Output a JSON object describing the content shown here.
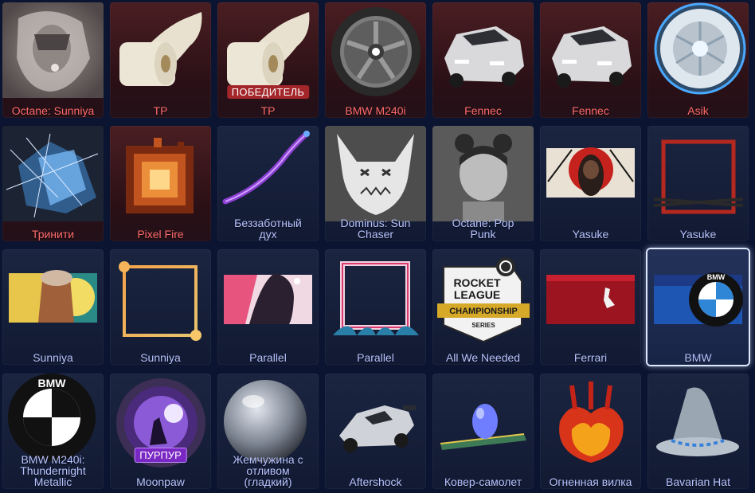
{
  "items": [
    {
      "name": "Octane: Sunniya",
      "rarity": "red"
    },
    {
      "name": "TP",
      "rarity": "red"
    },
    {
      "name": "TP",
      "rarity": "red",
      "badge": "ПОБЕДИТЕЛЬ"
    },
    {
      "name": "BMW M240i",
      "rarity": "red"
    },
    {
      "name": "Fennec",
      "rarity": "red"
    },
    {
      "name": "Fennec",
      "rarity": "red"
    },
    {
      "name": "Asik",
      "rarity": "red"
    },
    {
      "name": "Тринити",
      "rarity": "red"
    },
    {
      "name": "Pixel Fire",
      "rarity": "red"
    },
    {
      "name": "Беззаботный\nдух",
      "rarity": "blue"
    },
    {
      "name": "Dominus: Sun\nChaser",
      "rarity": "blue"
    },
    {
      "name": "Octane: Pop\nPunk",
      "rarity": "blue"
    },
    {
      "name": "Yasuke",
      "rarity": "blue"
    },
    {
      "name": "Yasuke",
      "rarity": "blue"
    },
    {
      "name": "Sunniya",
      "rarity": "blue"
    },
    {
      "name": "Sunniya",
      "rarity": "blue"
    },
    {
      "name": "Parallel",
      "rarity": "blue"
    },
    {
      "name": "Parallel",
      "rarity": "blue"
    },
    {
      "name": "All We Needed",
      "rarity": "blue"
    },
    {
      "name": "Ferrari",
      "rarity": "blue"
    },
    {
      "name": "BMW",
      "rarity": "blue",
      "selected": true
    },
    {
      "name": "BMW M240i:\nThundernight\nMetallic",
      "rarity": "blue"
    },
    {
      "name": "Moonpaw",
      "rarity": "blue",
      "badge": "ПУРПУР"
    },
    {
      "name": "Жемчужина с\nотливом\n(гладкий)",
      "rarity": "blue"
    },
    {
      "name": "Aftershock",
      "rarity": "blue"
    },
    {
      "name": "Ковер-самолет",
      "rarity": "blue"
    },
    {
      "name": "Огненная вилка",
      "rarity": "blue"
    },
    {
      "name": "Bavarian Hat",
      "rarity": "blue"
    }
  ],
  "logo_text": {
    "rlcs": [
      "ROCKET",
      "LEAGUE",
      "CHAMPIONSHIP",
      "SERIES"
    ],
    "bmw": "BMW"
  }
}
